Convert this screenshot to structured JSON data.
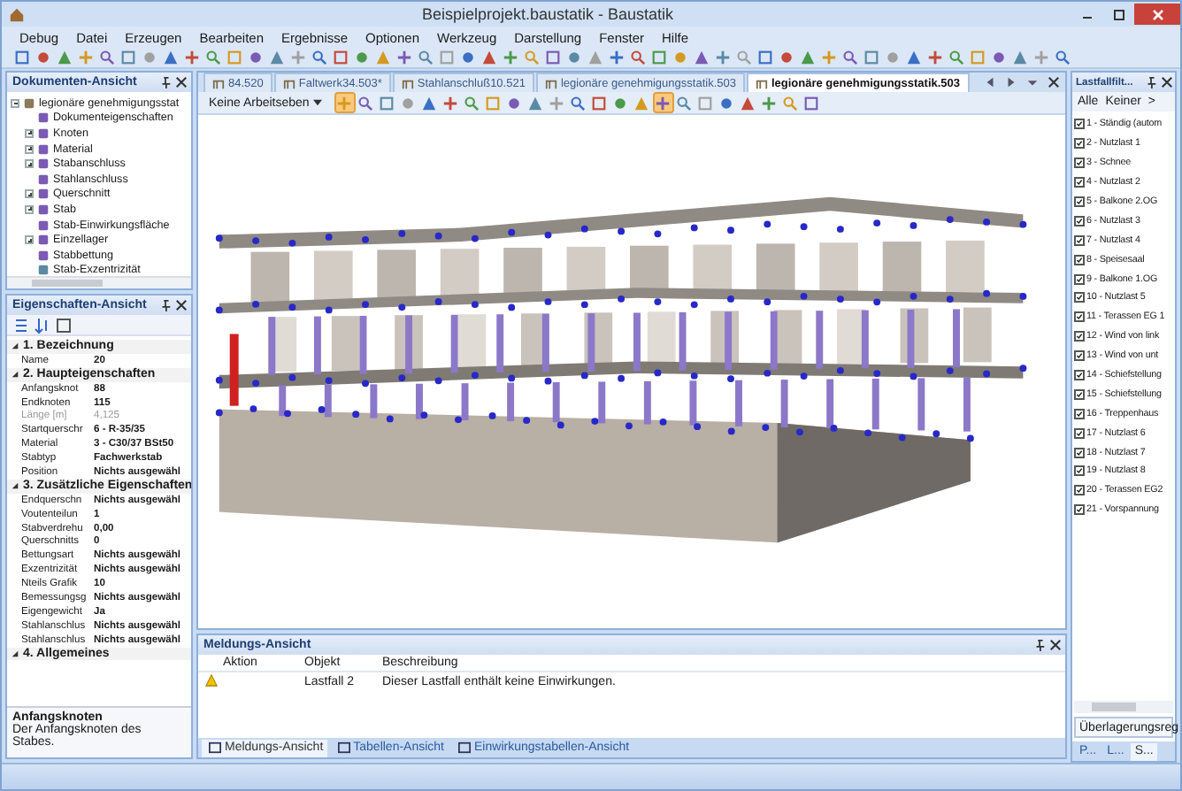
{
  "window": {
    "title": "Beispielprojekt.baustatik - Baustatik"
  },
  "menu": [
    "Debug",
    "Datei",
    "Erzeugen",
    "Bearbeiten",
    "Ergebnisse",
    "Optionen",
    "Werkzeug",
    "Darstellung",
    "Fenster",
    "Hilfe"
  ],
  "document_panel": {
    "title": "Dokumenten-Ansicht",
    "tree": [
      {
        "label": "legionäre genehmigungsstat",
        "expanded": true,
        "children": [
          {
            "label": "Dokumenteigenschaften",
            "kind": "leaf"
          },
          {
            "label": "Knoten",
            "kind": "folder"
          },
          {
            "label": "Material",
            "kind": "folder"
          },
          {
            "label": "Stabanschluss",
            "kind": "folder"
          },
          {
            "label": "Stahlanschluss",
            "kind": "leaf"
          },
          {
            "label": "Querschnitt",
            "kind": "folder"
          },
          {
            "label": "Stab",
            "kind": "folder"
          },
          {
            "label": "Stab-Einwirkungsfläche",
            "kind": "leaf"
          },
          {
            "label": "Einzellager",
            "kind": "folder"
          },
          {
            "label": "Stabbettung",
            "kind": "leaf"
          },
          {
            "label": "Stab-Exzentrizität",
            "kind": "leaf"
          }
        ]
      }
    ]
  },
  "properties_panel": {
    "title": "Eigenschaften-Ansicht",
    "categories": [
      {
        "label": "1. Bezeichnung",
        "expanded": true,
        "rows": [
          {
            "name": "Name",
            "value": "20",
            "disabled": false
          }
        ]
      },
      {
        "label": "2. Haupteigenschaften",
        "expanded": true,
        "rows": [
          {
            "name": "Anfangsknot",
            "value": "88",
            "disabled": false
          },
          {
            "name": "Endknoten",
            "value": "115",
            "disabled": false
          },
          {
            "name": "Länge [m]",
            "value": "4,125",
            "disabled": true
          },
          {
            "name": "Startquerschr",
            "value": "6 - R-35/35",
            "disabled": false
          },
          {
            "name": "Material",
            "value": "3 - C30/37 BSt50",
            "disabled": false
          },
          {
            "name": "Stabtyp",
            "value": "Fachwerkstab",
            "disabled": false
          },
          {
            "name": "Position",
            "value": "Nichts ausgewähl",
            "disabled": false
          }
        ]
      },
      {
        "label": "3. Zusätzliche Eigenschaften",
        "expanded": true,
        "rows": [
          {
            "name": "Endquerschn",
            "value": "Nichts ausgewähl",
            "disabled": false
          },
          {
            "name": "Voutenteilun",
            "value": "1",
            "disabled": false
          },
          {
            "name": "Stabverdrehu",
            "value": "0,00",
            "disabled": false
          },
          {
            "name": "Querschnitts",
            "value": "0",
            "disabled": false
          },
          {
            "name": "Bettungsart",
            "value": "Nichts ausgewähl",
            "disabled": false
          },
          {
            "name": "Exzentrizität",
            "value": "Nichts ausgewähl",
            "disabled": false
          },
          {
            "name": "Nteils Grafik",
            "value": "10",
            "disabled": false
          },
          {
            "name": "Bemessungsg",
            "value": "Nichts ausgewähl",
            "disabled": false
          },
          {
            "name": "Eigengewicht",
            "value": "Ja",
            "disabled": false
          },
          {
            "name": "Stahlanschlus",
            "value": "Nichts ausgewähl",
            "disabled": false
          },
          {
            "name": "Stahlanschlus",
            "value": "Nichts ausgewähl",
            "disabled": false
          }
        ]
      },
      {
        "label": "4. Allgemeines",
        "expanded": true
      }
    ],
    "description": {
      "title": "Anfangsknoten",
      "text": "Der Anfangsknoten des Stabes."
    }
  },
  "document_tabs": [
    {
      "label": "84.520",
      "selected": false
    },
    {
      "label": "Faltwerk34.503*",
      "selected": false
    },
    {
      "label": "Stahlanschluß10.521",
      "selected": false
    },
    {
      "label": "legionäre genehmigungsstatik.503",
      "selected": false
    },
    {
      "label": "legionäre genehmigungsstatik.503",
      "selected": true
    }
  ],
  "view_toolbar": {
    "workplane": "Keine Arbeitseben",
    "tools": [
      {
        "selected": true
      },
      {
        "selected": false
      },
      {
        "selected": false
      },
      {
        "selected": false
      },
      {
        "selected": false
      },
      {
        "selected": false
      },
      {
        "selected": false
      },
      {
        "selected": false
      },
      {
        "selected": false
      },
      {
        "selected": false
      },
      {
        "selected": false
      },
      {
        "selected": false
      },
      {
        "selected": false
      },
      {
        "selected": false
      },
      {
        "selected": false
      },
      {
        "selected": true
      },
      {
        "selected": false
      },
      {
        "selected": false
      },
      {
        "selected": false
      },
      {
        "selected": false
      },
      {
        "selected": false
      },
      {
        "selected": false
      },
      {
        "selected": false
      }
    ]
  },
  "message_panel": {
    "title": "Meldungs-Ansicht",
    "columns": [
      "Aktion",
      "Objekt",
      "Beschreibung"
    ],
    "rows": [
      {
        "kind": "warning",
        "object": "Lastfall 2",
        "description": "Dieser Lastfall enthält keine Einwirkungen."
      }
    ],
    "tabs": [
      {
        "label": "Meldungs-Ansicht",
        "selected": true
      },
      {
        "label": "Tabellen-Ansicht",
        "selected": false
      },
      {
        "label": "Einwirkungstabellen-Ansicht",
        "selected": false
      }
    ]
  },
  "load_case_panel": {
    "title": "Lastfallfilt...",
    "buttons": [
      "Alle",
      "Keiner",
      ">"
    ],
    "items": [
      {
        "label": "1 - Ständig (autom",
        "checked": true
      },
      {
        "label": "2 - Nutzlast 1",
        "checked": true
      },
      {
        "label": "3 - Schnee",
        "checked": true
      },
      {
        "label": "4 - Nutzlast 2",
        "checked": true
      },
      {
        "label": "5 - Balkone 2.OG",
        "checked": true
      },
      {
        "label": "6 - Nutzlast 3",
        "checked": true
      },
      {
        "label": "7 - Nutzlast 4",
        "checked": true
      },
      {
        "label": "8 - Speisesaal",
        "checked": true
      },
      {
        "label": "9 - Balkone 1.OG",
        "checked": true
      },
      {
        "label": "10 - Nutzlast 5",
        "checked": true
      },
      {
        "label": "11 - Terassen EG 1",
        "checked": true
      },
      {
        "label": "12 - Wind von link",
        "checked": true
      },
      {
        "label": "13 - Wind von unt",
        "checked": true
      },
      {
        "label": "14 - Schiefstellung",
        "checked": true
      },
      {
        "label": "15 - Schiefstellung",
        "checked": true
      },
      {
        "label": "16 - Treppenhaus",
        "checked": true
      },
      {
        "label": "17 - Nutzlast 6",
        "checked": true
      },
      {
        "label": "18 - Nutzlast 7",
        "checked": true
      },
      {
        "label": "19 - Nutzlast 8",
        "checked": true
      },
      {
        "label": "20 - Terassen EG2",
        "checked": true
      },
      {
        "label": "21 - Vorspannung",
        "checked": true
      }
    ],
    "dropdown": "Überlagerungsreg",
    "tabs": [
      {
        "label": "P...",
        "selected": false
      },
      {
        "label": "L...",
        "selected": false
      },
      {
        "label": "S...",
        "selected": true
      }
    ]
  }
}
